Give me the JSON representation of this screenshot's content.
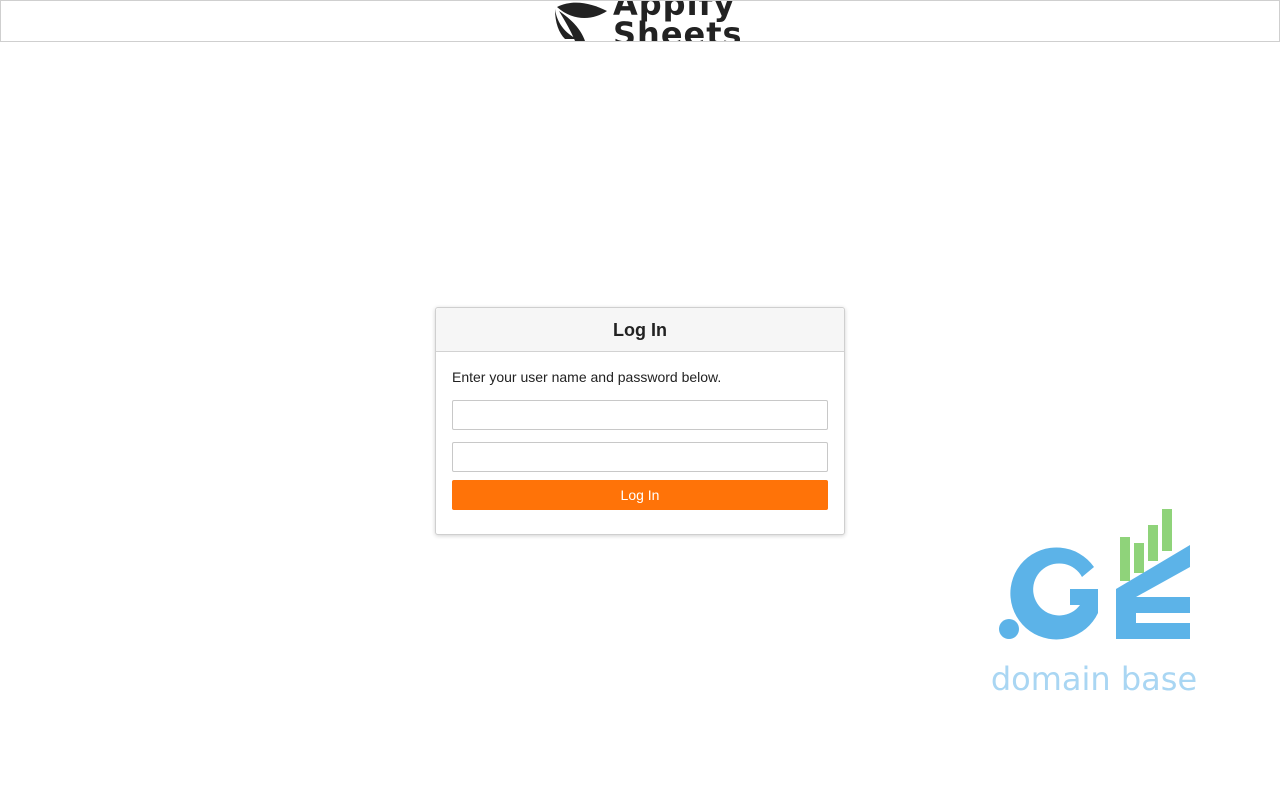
{
  "header": {
    "logo_text": "Appify\nSheets"
  },
  "login": {
    "title": "Log In",
    "instructions": "Enter your user name and password below.",
    "username_value": "",
    "password_value": "",
    "button_label": "Log In"
  },
  "domain_logo": {
    "mark_text": ".GE",
    "caption": "domain base",
    "colors": {
      "blue": "#5cb3e8",
      "light_blue": "#a9d6f3",
      "green": "#8fd37a"
    }
  },
  "colors": {
    "accent": "#ff7308",
    "header_bg": "#f6f6f6",
    "border": "#cfcfcf"
  }
}
